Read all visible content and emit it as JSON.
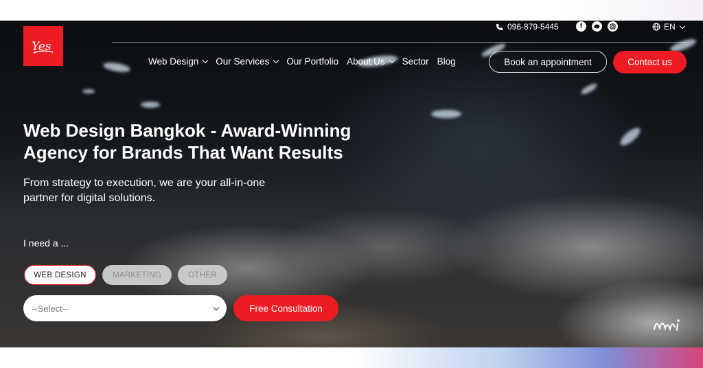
{
  "brand": {
    "logo_text": "Yes",
    "accent": "#ed1c24"
  },
  "topbar": {
    "phone": "096-879-5445",
    "social_icons": [
      "facebook-icon",
      "line-icon",
      "instagram-icon"
    ],
    "language": "EN"
  },
  "nav": {
    "items": [
      {
        "label": "Web Design",
        "has_dropdown": true
      },
      {
        "label": "Our Services",
        "has_dropdown": true
      },
      {
        "label": "Our Portfolio",
        "has_dropdown": false
      },
      {
        "label": "About Us",
        "has_dropdown": true
      },
      {
        "label": "Sector",
        "has_dropdown": false
      },
      {
        "label": "Blog",
        "has_dropdown": false
      }
    ],
    "book_label": "Book an appointment",
    "contact_label": "Contact us"
  },
  "hero": {
    "headline_line1": "Web Design Bangkok - Award-Winning",
    "headline_line2": "Agency for Brands That Want Results",
    "sub_line1": "From strategy to execution, we are your all-in-one",
    "sub_line2": "partner for digital solutions.",
    "prompt": "I need a ...",
    "options": [
      {
        "label": "WEB DESIGN",
        "active": true
      },
      {
        "label": "MARKETING",
        "active": false
      },
      {
        "label": "OTHER",
        "active": false
      }
    ],
    "select_value": "--Select--",
    "cta_label": "Free Consultation"
  }
}
